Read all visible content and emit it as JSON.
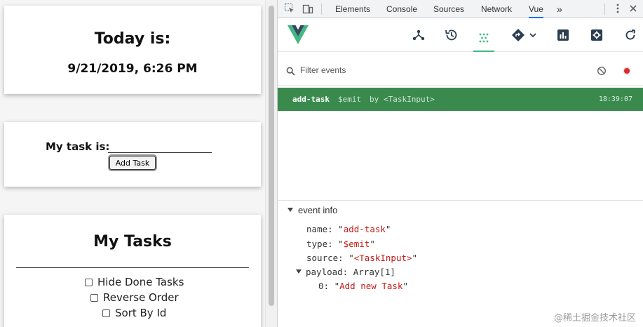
{
  "left": {
    "today_title": "Today is:",
    "date_text": "9/21/2019, 6:26 PM",
    "task_label": "My task is:",
    "task_input_value": "",
    "add_button_label": "Add Task",
    "tasks_title": "My Tasks",
    "options": [
      {
        "label": "Hide Done Tasks",
        "checked": false
      },
      {
        "label": "Reverse Order",
        "checked": false
      },
      {
        "label": "Sort By Id",
        "checked": false
      }
    ]
  },
  "devtools": {
    "tabs": [
      "Elements",
      "Console",
      "Sources",
      "Network",
      "Vue"
    ],
    "active_tab": "Vue",
    "more_tabs": "»",
    "vue_tools": [
      "components-icon",
      "history-icon",
      "events-icon",
      "routing-icon",
      "performance-icon",
      "settings-icon",
      "refresh-icon"
    ],
    "active_tool": "events-icon",
    "filter_placeholder": "Filter events",
    "event": {
      "name": "add-task",
      "type": "$emit",
      "by": "by",
      "source": "<TaskInput>",
      "time": "18:39:07"
    },
    "event_info": {
      "heading": "event info",
      "name_key": "name:",
      "name_val": "add-task",
      "type_key": "type:",
      "type_val": "$emit",
      "source_key": "source:",
      "source_val": "<TaskInput>",
      "payload_key": "payload:",
      "payload_val": "Array[1]",
      "item_key": "0:",
      "item_val": "Add new Task"
    },
    "colors": {
      "accent": "#42b883",
      "event_row": "#3a8a4e",
      "string": "#c41a16"
    }
  },
  "watermark": "@稀土掘金技术社区"
}
